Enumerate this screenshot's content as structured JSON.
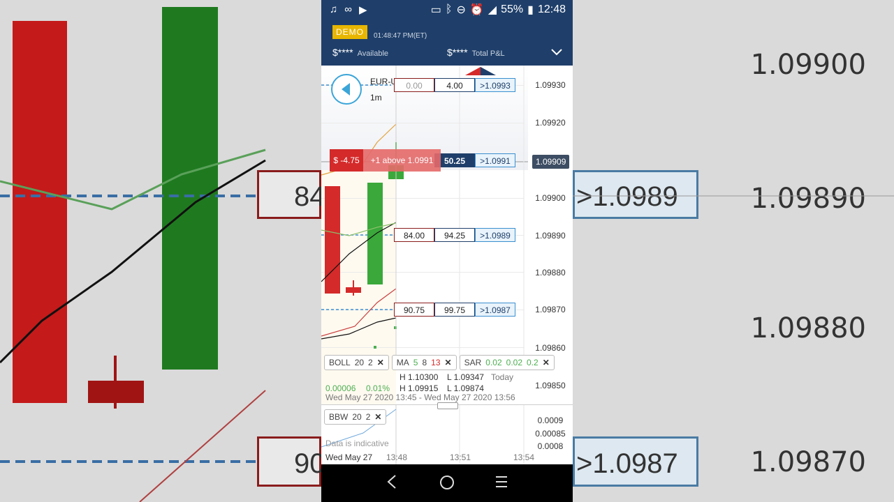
{
  "status_bar": {
    "battery": "55%",
    "time": "12:48"
  },
  "header": {
    "demo_label": "DEMO",
    "clock": "01:48:47 PM(ET)",
    "available_value": "$****",
    "available_label": "Available",
    "pnl_value": "$****",
    "pnl_label": "Total P&L"
  },
  "chart": {
    "symbol": "EUR-USD (31-DEC-20)",
    "timeframe": "1m",
    "price_ticks": [
      "1.09930",
      "1.09920",
      "1.09900",
      "1.09890",
      "1.09880",
      "1.09870",
      "1.09860",
      "1.09850"
    ],
    "current_price": "1.09909",
    "ladder": [
      {
        "bid": "0.00",
        "offer": "4.00",
        "target": ">1.0993"
      },
      {
        "offer": "50.25",
        "target": ">1.0991"
      },
      {
        "bid": "84.00",
        "offer": "94.25",
        "target": ">1.0989"
      },
      {
        "bid": "90.75",
        "offer": "99.75",
        "target": ">1.0987"
      }
    ],
    "position": {
      "pnl": "$ -4.75",
      "description": "+1 above 1.0991"
    }
  },
  "indicators": {
    "boll": {
      "name": "BOLL",
      "p1": "20",
      "p2": "2"
    },
    "ma": {
      "name": "MA",
      "p1": "5",
      "p2": "8",
      "p3": "13"
    },
    "sar": {
      "name": "SAR",
      "p1": "0.02",
      "p2": "0.02",
      "p3": "0.2"
    },
    "bbw": {
      "name": "BBW",
      "p1": "20",
      "p2": "2"
    },
    "close_symbol": "✕"
  },
  "stats": {
    "change_abs": "0.00006",
    "change_pct": "0.01%",
    "high_label_1": "H 1.10300",
    "low_label_1": "L 1.09347",
    "period_label": "Today",
    "high_label_2": "H 1.09915",
    "low_label_2": "L 1.09874",
    "date_range": "Wed May 27 2020 13:45 - Wed May 27 2020 13:56"
  },
  "lower_panel": {
    "ticks": [
      "0.0009",
      "0.00085",
      "0.0008"
    ],
    "note": "Data is indicative"
  },
  "time_axis": {
    "date": "Wed May 27",
    "t1": "13:48",
    "t2": "13:51",
    "t3": "13:54"
  },
  "background": {
    "prices": [
      "1.09900",
      "1.09890",
      "1.09880",
      "1.09870"
    ],
    "box_left_1": "84",
    "box_right_1": ">1.0989",
    "box_left_2": "90",
    "box_right_2": ">1.0987"
  },
  "colors": {
    "navy": "#1f3f6a",
    "red": "#d42a2a",
    "green": "#3aa83a",
    "demo": "#e8b600"
  }
}
